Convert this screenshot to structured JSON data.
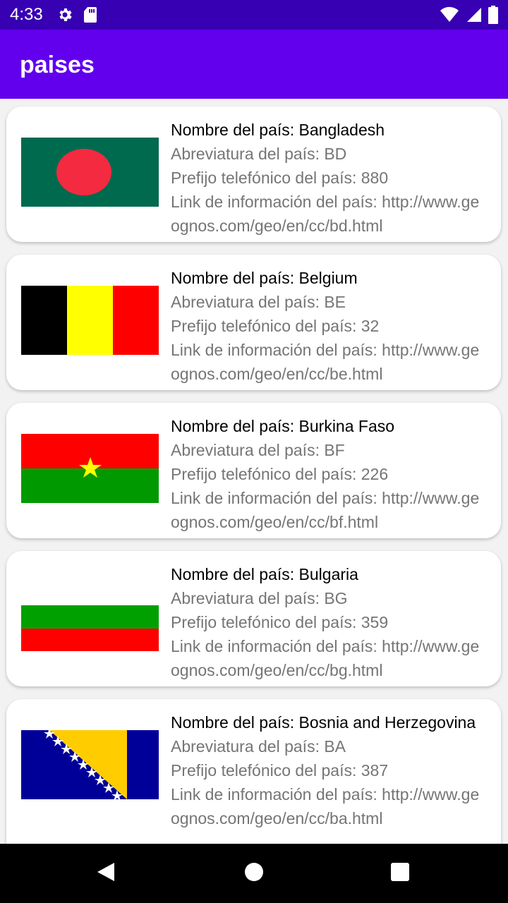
{
  "status_bar": {
    "time": "4:33"
  },
  "app_bar": {
    "title": "paises"
  },
  "countries": [
    {
      "name": "Nombre del país: Bangladesh",
      "abbr": "Abreviatura del país: BD",
      "prefix": "Prefijo telefónico del país: 880",
      "link": "Link de información del país: http://www.geognos.com/geo/en/cc/bd.html",
      "flag": "bangladesh-flag"
    },
    {
      "name": "Nombre del país: Belgium",
      "abbr": "Abreviatura del país: BE",
      "prefix": "Prefijo telefónico del país: 32",
      "link": "Link de información del país: http://www.geognos.com/geo/en/cc/be.html",
      "flag": "belgium-flag"
    },
    {
      "name": "Nombre del país: Burkina Faso",
      "abbr": "Abreviatura del país: BF",
      "prefix": "Prefijo telefónico del país: 226",
      "link": "Link de información del país: http://www.geognos.com/geo/en/cc/bf.html",
      "flag": "burkina-faso-flag"
    },
    {
      "name": "Nombre del país: Bulgaria",
      "abbr": "Abreviatura del país: BG",
      "prefix": "Prefijo telefónico del país: 359",
      "link": "Link de información del país: http://www.geognos.com/geo/en/cc/bg.html",
      "flag": "bulgaria-flag"
    },
    {
      "name": "Nombre del país: Bosnia and Herzegovina",
      "abbr": "Abreviatura del país: BA",
      "prefix": "Prefijo telefónico del país: 387",
      "link": "Link de información del país: http://www.geognos.com/geo/en/cc/ba.html",
      "flag": "bosnia-herzegovina-flag"
    }
  ],
  "colors": {
    "status_bar": "#3700b3",
    "app_bar": "#6200ee",
    "secondary_text": "#757575"
  }
}
